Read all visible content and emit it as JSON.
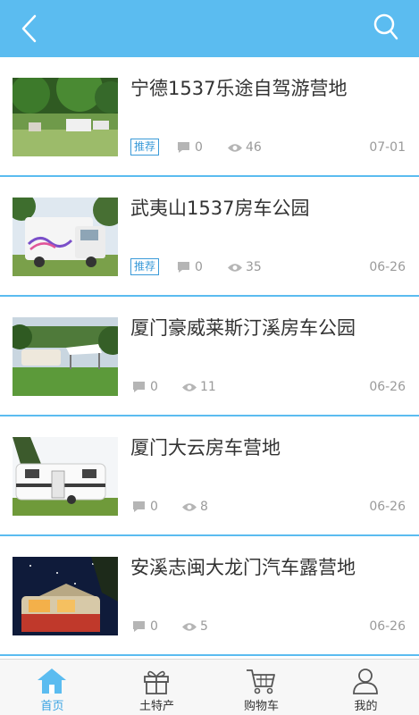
{
  "colors": {
    "accent": "#5bbcf0",
    "tag": "#3a9ad8",
    "meta": "#9a9a9a"
  },
  "header": {
    "back_icon": "back-chevron-icon",
    "search_icon": "search-icon"
  },
  "items": [
    {
      "title": "宁德1537乐途自驾游营地",
      "tag": "推荐",
      "comments": "0",
      "views": "46",
      "date": "07-01"
    },
    {
      "title": "武夷山1537房车公园",
      "tag": "推荐",
      "comments": "0",
      "views": "35",
      "date": "06-26"
    },
    {
      "title": "厦门豪威莱斯汀溪房车公园",
      "tag": "",
      "comments": "0",
      "views": "11",
      "date": "06-26"
    },
    {
      "title": "厦门大云房车营地",
      "tag": "",
      "comments": "0",
      "views": "8",
      "date": "06-26"
    },
    {
      "title": "安溪志闽大龙门汽车露营地",
      "tag": "",
      "comments": "0",
      "views": "5",
      "date": "06-26"
    }
  ],
  "tabbar": [
    {
      "label": "首页",
      "icon": "home-icon",
      "active": true
    },
    {
      "label": "土特产",
      "icon": "gift-icon",
      "active": false
    },
    {
      "label": "购物车",
      "icon": "cart-icon",
      "active": false
    },
    {
      "label": "我的",
      "icon": "user-icon",
      "active": false
    }
  ]
}
